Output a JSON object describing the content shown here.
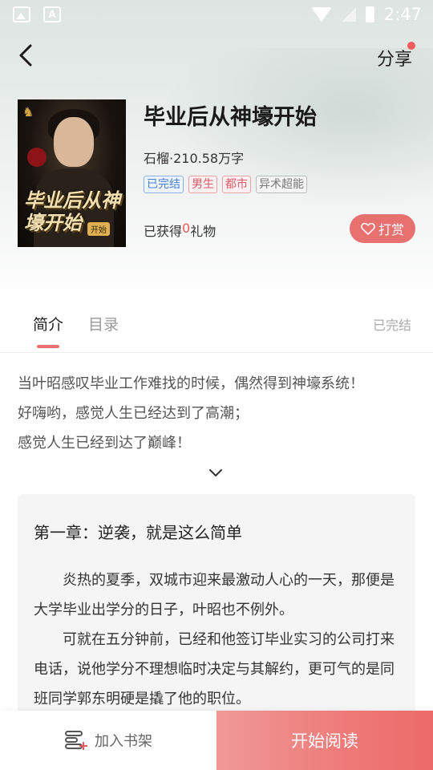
{
  "status_bar": {
    "time": "2:47"
  },
  "nav": {
    "share_label": "分享"
  },
  "book": {
    "title": "毕业后从神壕开始",
    "meta": "石榴·210.58万字",
    "tags": [
      "已完结",
      "男生",
      "都市",
      "异术超能"
    ],
    "gift_prefix": "已获得",
    "gift_count": "0",
    "gift_suffix": "礼物",
    "reward_label": "打赏",
    "cover_title": "毕业后从神壕开始",
    "cover_tag": "开始"
  },
  "tabs": {
    "intro": "简介",
    "toc": "目录",
    "status": "已完结"
  },
  "intro_lines": [
    "当叶昭感叹毕业工作难找的时候，偶然得到神壕系统！",
    "好嗨哟，感觉人生已经达到了高潮；",
    "感觉人生已经到达了巅峰！"
  ],
  "chapter": {
    "title": "第一章：逆袭，就是这么简单",
    "paragraphs": [
      "炎热的夏季，双城市迎来最激动人心的一天，那便是大学毕业出学分的日子，叶昭也不例外。",
      "可就在五分钟前，已经和他签订毕业实习的公司打来电话，说他学分不理想临时决定与其解约，更可气的是同班同学郭东明硬是撬了他的职位。"
    ]
  },
  "bottom": {
    "add_shelf": "加入书架",
    "start_read": "开始阅读"
  },
  "colors": {
    "accent": "#e8706f",
    "gift_count": "#f25c5c",
    "tag_blue": "#4a7fd6"
  }
}
